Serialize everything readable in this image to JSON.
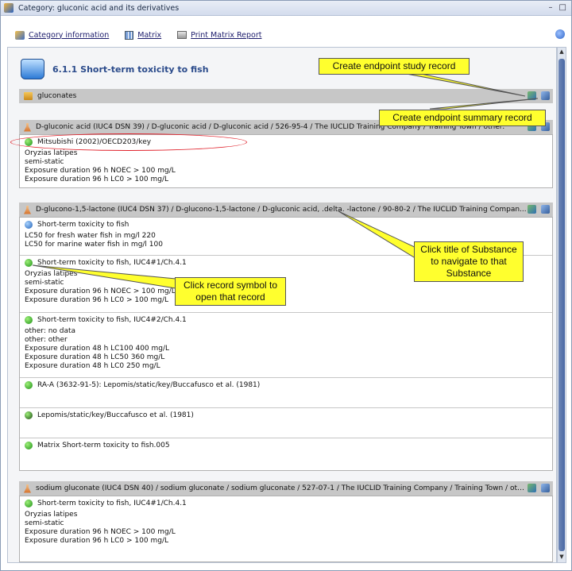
{
  "window": {
    "title": "Category: gluconic acid and its derivatives",
    "min_glyph": "–",
    "max_glyph": "□"
  },
  "toolbar": {
    "category_information": "Category information",
    "matrix": "Matrix",
    "print_matrix_report": "Print Matrix Report"
  },
  "section": {
    "title": "6.1.1 Short-term toxicity to fish"
  },
  "category_bar": {
    "label": "gluconates"
  },
  "substances": [
    {
      "title": "D-gluconic acid (IUC4 DSN 39) / D-gluconic acid / D-gluconic acid / 526-95-4 / The IUCLID Training Company / Training Town / other:",
      "records": [
        {
          "name": "Mitsubishi (2002)/OECD203/key",
          "lines": [
            "Oryzias latipes",
            "semi-static",
            "Exposure duration 96 h NOEC > 100  mg/L",
            "Exposure duration 96 h LC0 > 100  mg/L"
          ]
        }
      ]
    },
    {
      "title": "D-glucono-1,5-lactone (IUC4 DSN 37) / D-glucono-1,5-lactone / D-gluconic acid, .delta. -lactone / 90-80-2 / The IUCLID Training Compan...",
      "records": [
        {
          "name": "Short-term toxicity to fish",
          "lines": [
            "LC50 for fresh water fish in mg/l 220",
            "LC50 for marine water fish in mg/l 100"
          ]
        },
        {
          "name": "Short-term toxicity to fish, IUC4#1/Ch.4.1",
          "lines": [
            "Oryzias latipes",
            "semi-static",
            "Exposure duration 96 h NOEC > 100  mg/L",
            "Exposure duration 96 h LC0 > 100  mg/L"
          ]
        },
        {
          "name": "Short-term toxicity to fish, IUC4#2/Ch.4.1",
          "lines": [
            "other: no data",
            "other: other",
            "Exposure duration 48 h LC100 400  mg/L",
            "Exposure duration 48 h LC50 360  mg/L",
            "Exposure duration 48 h LC0 250  mg/L"
          ]
        },
        {
          "name": "RA-A (3632-91-5): Lepomis/static/key/Buccafusco et al. (1981)",
          "lines": []
        },
        {
          "name": "Lepomis/static/key/Buccafusco et al. (1981)",
          "lines": []
        },
        {
          "name": "Matrix Short-term toxicity to fish.005",
          "lines": []
        }
      ]
    },
    {
      "title": "sodium gluconate (IUC4 DSN 40) / sodium gluconate / sodium gluconate / 527-07-1 / The IUCLID Training Company / Training Town / oth...",
      "records": [
        {
          "name": "Short-term toxicity to fish, IUC4#1/Ch.4.1",
          "lines": [
            "Oryzias latipes",
            "semi-static",
            "Exposure duration 96 h NOEC > 100  mg/L",
            "Exposure duration 96 h LC0 > 100  mg/L"
          ]
        }
      ]
    }
  ],
  "callouts": {
    "study_record": "Create endpoint study record",
    "summary_record": "Create endpoint summary record",
    "substance_title": "Click title of Substance to navigate to that Substance",
    "record_symbol": "Click record symbol to open that record"
  }
}
